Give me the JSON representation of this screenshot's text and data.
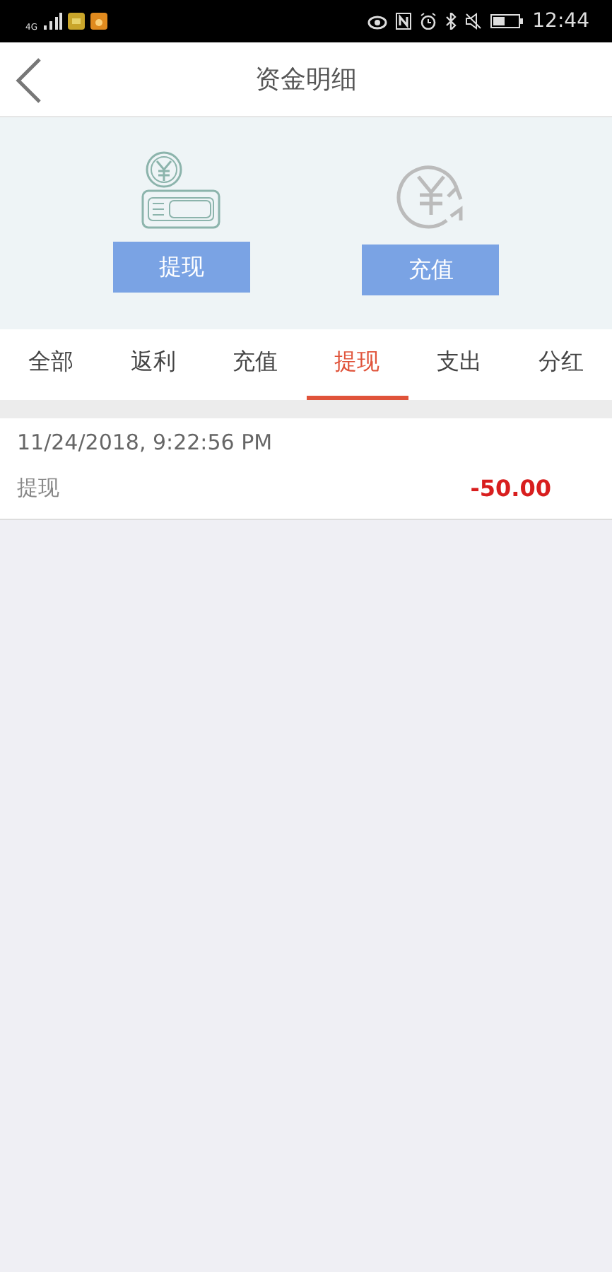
{
  "status_bar": {
    "network": "4G",
    "time": "12:44"
  },
  "header": {
    "title": "资金明细"
  },
  "actions": [
    {
      "kind": "withdraw",
      "label": "提现"
    },
    {
      "kind": "recharge",
      "label": "充值"
    }
  ],
  "tabs": [
    {
      "label": "全部",
      "selected": false
    },
    {
      "label": "返利",
      "selected": false
    },
    {
      "label": "充值",
      "selected": false
    },
    {
      "label": "提现",
      "selected": true
    },
    {
      "label": "支出",
      "selected": false
    },
    {
      "label": "分红",
      "selected": false
    }
  ],
  "records": [
    {
      "time": "11/24/2018, 9:22:56 PM",
      "type": "提现",
      "amount": "-50.00"
    }
  ]
}
